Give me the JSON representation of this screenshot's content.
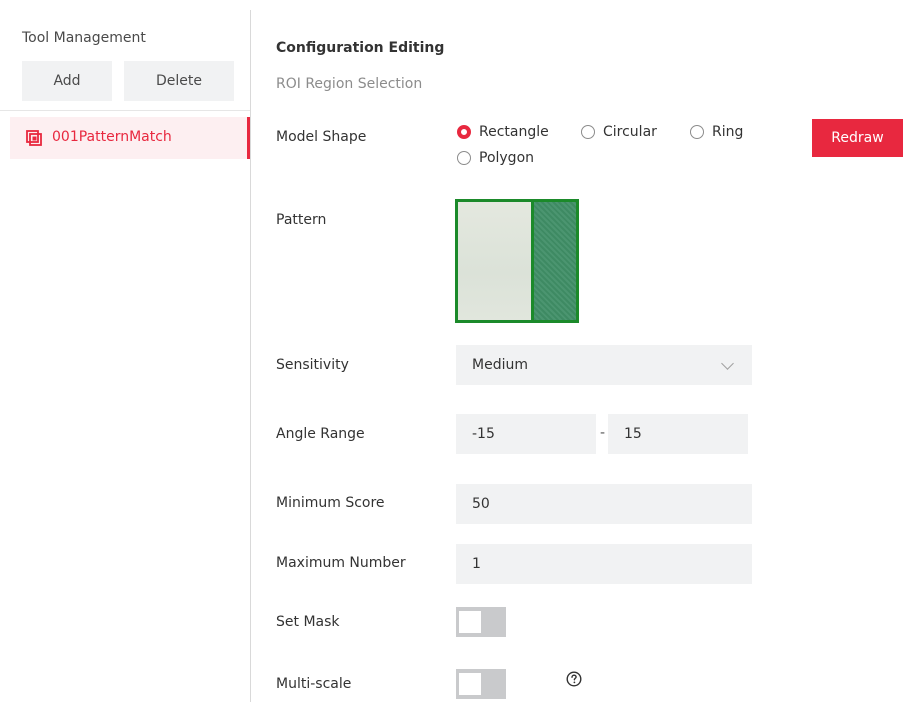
{
  "sidebar": {
    "title": "Tool Management",
    "add_label": "Add",
    "delete_label": "Delete",
    "tools": [
      {
        "label": "001PatternMatch",
        "icon": "pattern-match-icon",
        "selected": true
      }
    ]
  },
  "main": {
    "title": "Configuration Editing",
    "subtitle": "ROI Region Selection",
    "model_shape": {
      "label": "Model Shape",
      "options": [
        "Rectangle",
        "Circular",
        "Ring",
        "Polygon"
      ],
      "selected": "Rectangle"
    },
    "redraw_label": "Redraw",
    "pattern": {
      "label": "Pattern"
    },
    "sensitivity": {
      "label": "Sensitivity",
      "value": "Medium"
    },
    "angle_range": {
      "label": "Angle Range",
      "min": "-15",
      "separator": "-",
      "max": "15"
    },
    "minimum_score": {
      "label": "Minimum Score",
      "value": "50"
    },
    "maximum_number": {
      "label": "Maximum Number",
      "value": "1"
    },
    "set_mask": {
      "label": "Set Mask",
      "on": false
    },
    "multi_scale": {
      "label": "Multi-scale",
      "on": false,
      "help_icon": "help-circle-icon"
    }
  },
  "colors": {
    "accent": "#e8283f",
    "selected_bg": "#fdeff1",
    "field_bg": "#f1f2f3",
    "pattern_border": "#1b8a2a"
  }
}
